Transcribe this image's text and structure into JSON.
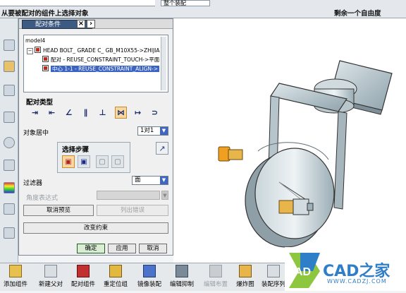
{
  "top": {
    "type_combo": "整个装配",
    "prompt": "从要被配对的组件上选择对象",
    "status": "剩余一个自由度"
  },
  "dialog": {
    "tab_title": "配对条件",
    "tree": {
      "root": "model4",
      "rows": [
        "HEAD BOLT_ GRADE C_ GB_M10X55->ZHIJIA",
        "配对 - REUSE_CONSTRAINT_TOUCH->平面",
        "中心 1-1 - REUSE_CONSTRAINT_ALIGN->"
      ]
    },
    "constraint_type_label": "配对类型",
    "constraint_icons": [
      "mate-icon",
      "align-icon",
      "angle-icon",
      "parallel-icon",
      "perpendicular-icon",
      "center-icon",
      "distance-icon",
      "tangent-icon"
    ],
    "object_center_label": "对象居中",
    "object_center_value": "1对1",
    "steps_label": "选择步骤",
    "filter_label": "过滤器",
    "filter_value": "面",
    "angle_expr_label": "角度表达式",
    "cancel_preview": "取消预览",
    "list_errors": "列出错误",
    "change_constraint": "改变约束",
    "ok": "确定",
    "apply": "应用",
    "cancel": "取消"
  },
  "bottom": {
    "items": [
      "添加组件",
      "新建父对",
      "配对组件",
      "重定位组",
      "镜像装配",
      "编辑抑制",
      "编辑布置",
      "爆炸图",
      "装配序列"
    ]
  },
  "logo": {
    "text_main": "CAD之家",
    "url": "WWW.CADZJ.COM",
    "ad_letters": "AD"
  },
  "colors": {
    "tab_bg": "#3d5a82",
    "selection": "#3a63c4",
    "active_button": "#f7d7a2",
    "logo_blue": "#2f7ec8"
  }
}
